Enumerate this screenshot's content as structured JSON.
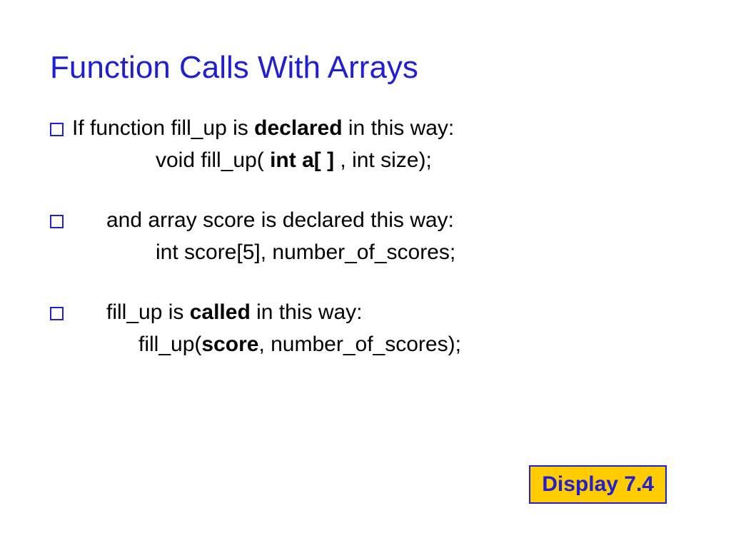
{
  "title": "Function Calls With Arrays",
  "bullets": [
    {
      "pre": "If function fill_up is ",
      "bold1": "declared",
      "post": " in this way:",
      "sub_pre": "void fill_up( ",
      "sub_bold": "int a[ ]",
      "sub_post": " , int size);"
    },
    {
      "pre": "and array score is declared this way:",
      "sub": "int score[5], number_of_scores;"
    },
    {
      "pre": "fill_up is ",
      "bold1": "called",
      "post": " in this way:",
      "sub_pre": "fill_up(",
      "sub_bold": "score",
      "sub_post": ", number_of_scores);"
    }
  ],
  "display_label": "Display 7.4"
}
